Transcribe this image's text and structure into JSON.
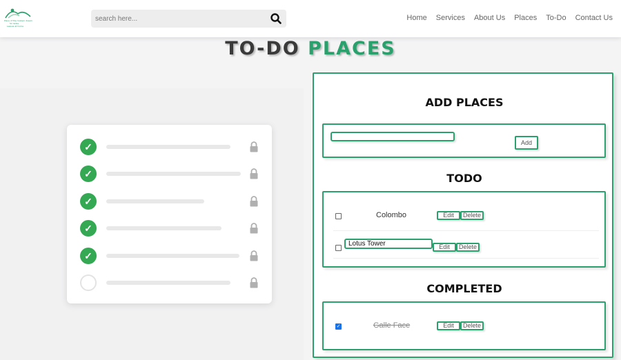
{
  "header": {
    "logo_text": [
      "Place of the modern dream",
      "Sri lanka",
      "Leaves at home"
    ],
    "search": {
      "placeholder": "search here..."
    },
    "nav": [
      "Home",
      "Services",
      "About Us",
      "Places",
      "To-Do",
      "Contact Us"
    ]
  },
  "page_title": {
    "part1": "TO-DO",
    "part2": "PLACES"
  },
  "add_section": {
    "title": "ADD PLACES",
    "input_value": "",
    "add_label": "Add"
  },
  "todo_section": {
    "title": "TODO",
    "items": [
      {
        "label": "Colombo",
        "checked": false,
        "editing": false,
        "edit_label": "Edit",
        "delete_label": "Delete"
      },
      {
        "label": "Lotus Tower",
        "checked": false,
        "editing": true,
        "edit_label": "Edit",
        "delete_label": "Delete"
      }
    ]
  },
  "completed_section": {
    "title": "COMPLETED",
    "items": [
      {
        "label": "Galle Face",
        "checked": true,
        "edit_label": "Edit",
        "delete_label": "Delete"
      }
    ]
  },
  "colors": {
    "accent": "#2aa16c",
    "check_green": "#34a853",
    "title_dark": "#3a3a3a"
  },
  "icons": {
    "search": "search-icon",
    "lock": "lock-icon",
    "check": "check-circle-icon"
  }
}
